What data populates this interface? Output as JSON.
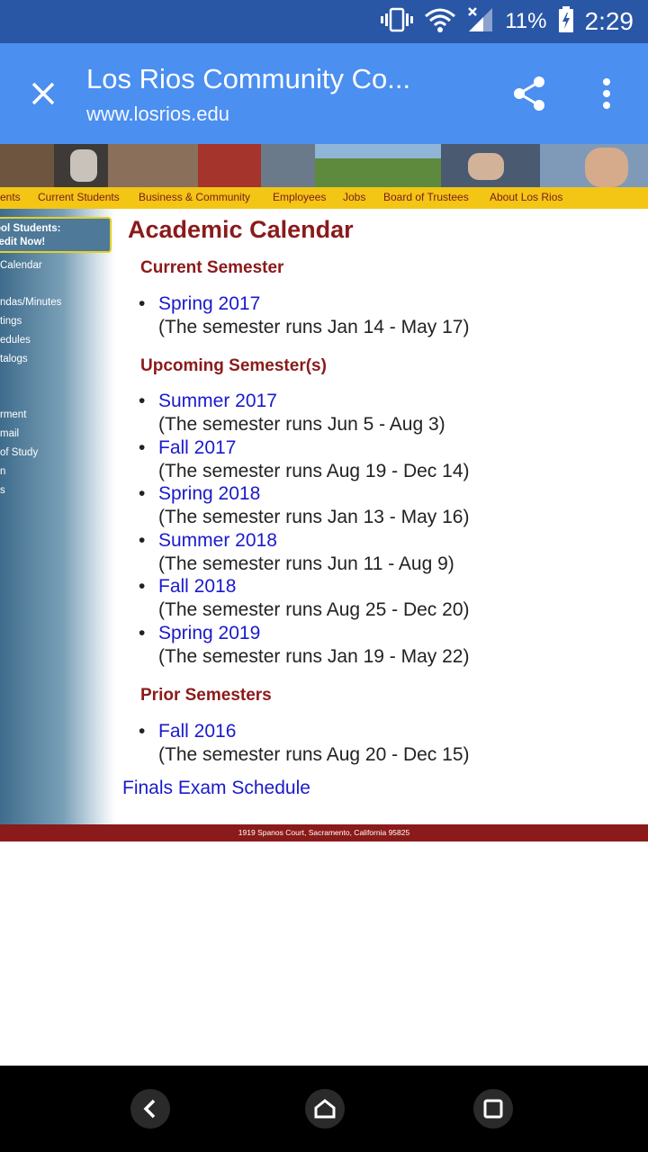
{
  "status_bar": {
    "battery_percent": "11%",
    "time": "2:29",
    "icons": [
      "vibrate-icon",
      "wifi-icon",
      "signal-icon",
      "battery-charging-icon"
    ]
  },
  "custom_tab": {
    "title": "Los Rios Community Co...",
    "url": "www.losrios.edu",
    "icons": [
      "close-icon",
      "share-icon",
      "more-vert-icon"
    ]
  },
  "nav": {
    "items": [
      "ents",
      "Current Students",
      "Business & Community",
      "Employees",
      "Jobs",
      "Board of Trustees",
      "About Los Rios"
    ]
  },
  "sidebar": {
    "highlight": {
      "line1": "ool Students:",
      "line2": "redit Now!"
    },
    "links": [
      "Calendar",
      "ndas/Minutes",
      "tings",
      "edules",
      "talogs",
      "rment",
      "mail",
      "of Study",
      "n",
      "s"
    ]
  },
  "main": {
    "title": "Academic Calendar",
    "sections": [
      {
        "heading": "Current Semester",
        "items": [
          {
            "link": "Spring 2017",
            "desc": "(The semester runs Jan 14 - May 17)"
          }
        ]
      },
      {
        "heading": "Upcoming Semester(s)",
        "items": [
          {
            "link": "Summer 2017",
            "desc": "(The semester runs Jun 5 - Aug 3)"
          },
          {
            "link": "Fall 2017",
            "desc": "(The semester runs Aug 19 - Dec 14)"
          },
          {
            "link": "Spring 2018",
            "desc": "(The semester runs Jan 13 - May 16)"
          },
          {
            "link": "Summer 2018",
            "desc": "(The semester runs Jun 11 - Aug 9)"
          },
          {
            "link": "Fall 2018",
            "desc": "(The semester runs Aug 25 - Dec 20)"
          },
          {
            "link": "Spring 2019",
            "desc": "(The semester runs Jan 19 - May 22)"
          }
        ]
      },
      {
        "heading": "Prior Semesters",
        "items": [
          {
            "link": "Fall 2016",
            "desc": "(The semester runs Aug 20 - Dec 15)"
          }
        ]
      }
    ],
    "finals_link": "Finals Exam Schedule"
  },
  "footer": {
    "address": "1919 Spanos Court, Sacramento, California 95825"
  },
  "colors": {
    "status_bar": "#2a56a6",
    "header": "#4b8ff0",
    "nav": "#f3c515",
    "heading": "#8b1a1a",
    "link": "#1a1acc"
  }
}
